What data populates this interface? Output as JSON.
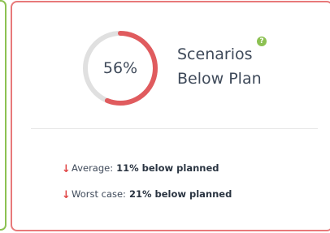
{
  "card": {
    "gauge": {
      "value_text": "56%",
      "percent": 56,
      "track_color": "#e0e0e0",
      "fill_color": "#e05b5e"
    },
    "title_line1": "Scenarios",
    "title_line2": "Below Plan",
    "help_icon": {
      "glyph": "?",
      "color": "#8cc152"
    },
    "stats": [
      {
        "icon": "down-arrow-icon",
        "label": "Average:",
        "value": "11% below planned"
      },
      {
        "icon": "down-arrow-icon",
        "label": "Worst case:",
        "value": "21% below planned"
      }
    ]
  }
}
